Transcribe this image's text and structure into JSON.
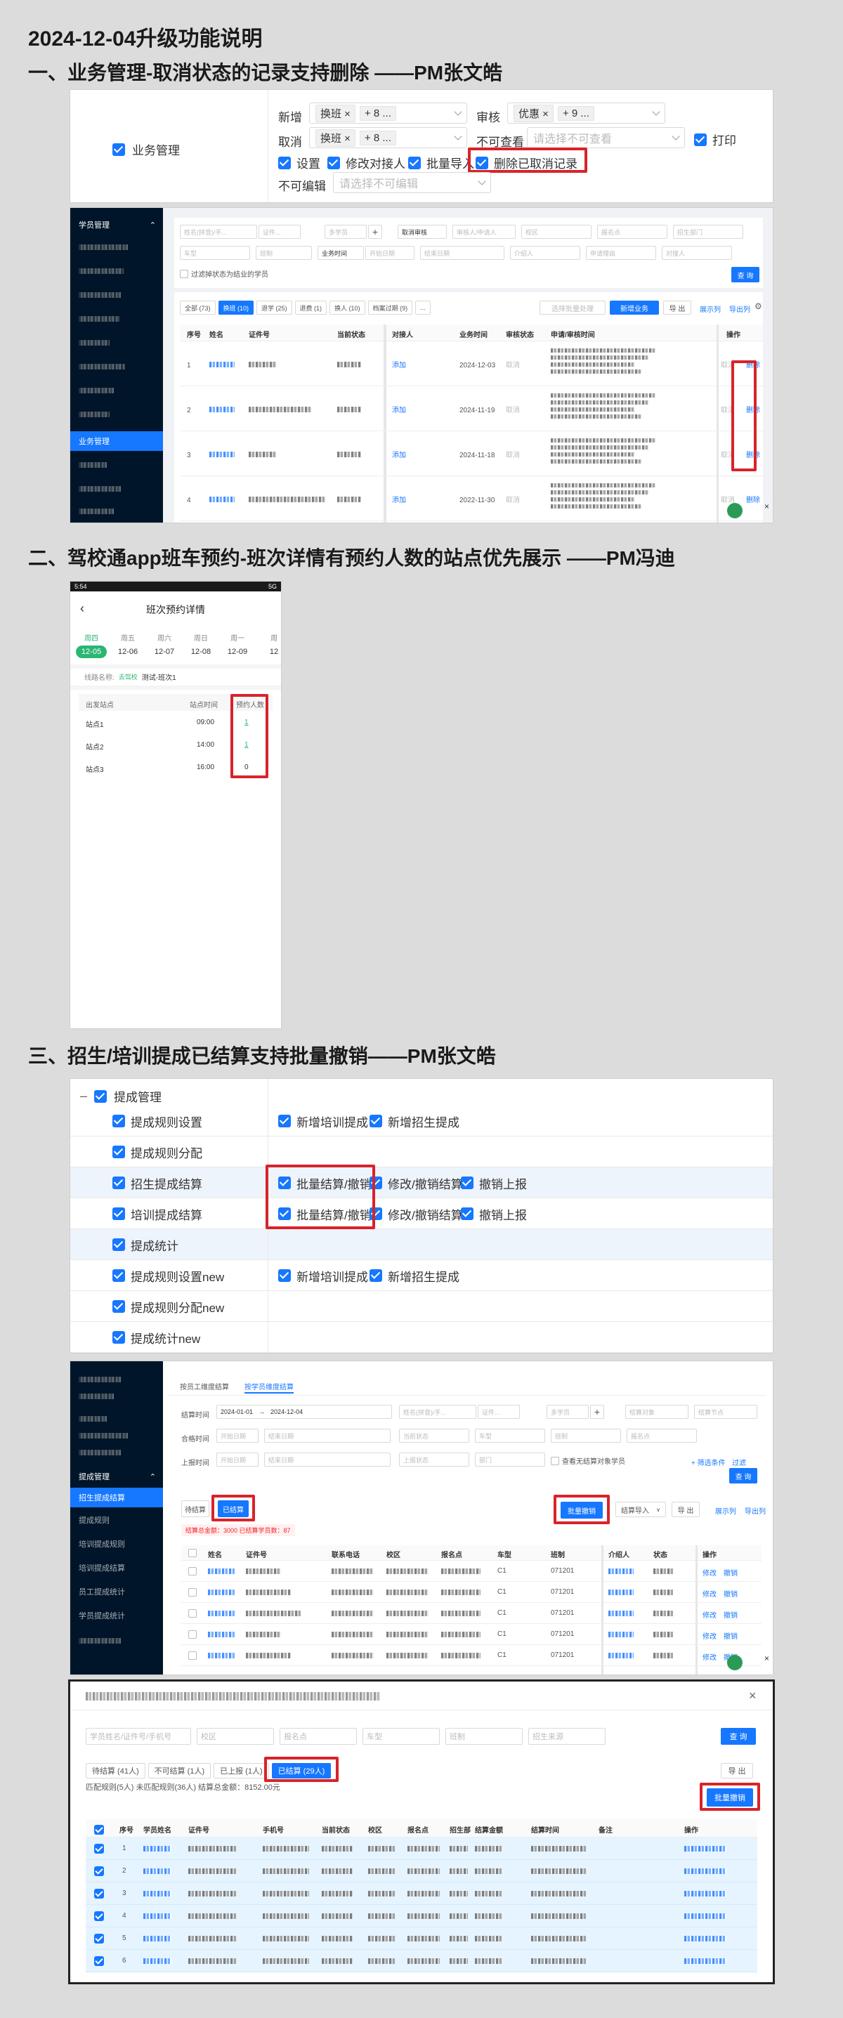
{
  "doc_title": "2024-12-04升级功能说明",
  "sections": [
    {
      "heading": "一、业务管理-取消状态的记录支持删除 ——PM张文皓"
    },
    {
      "heading": "二、驾校通app班车预约-班次详情有预约人数的站点优先展示 ——PM冯迪"
    },
    {
      "heading": "三、招生/培训提成已结算支持批量撤销——PM张文皓"
    }
  ],
  "perm": {
    "main_label": "业务管理",
    "add_label": "新增",
    "add_tag": "换班",
    "add_more": "+ 8 ...",
    "audit_label": "审核",
    "audit_tag": "优惠",
    "audit_more": "+ 9 ...",
    "cancel_label": "取消",
    "cancel_tag": "换班",
    "cancel_more": "+ 8 ...",
    "noview_label": "不可查看",
    "noview_placeholder": "请选择不可查看",
    "print_label": "打印",
    "setting_label": "设置",
    "modify_label": "修改对接人",
    "batch_label": "批量导入",
    "delete_cancel_label": "删除已取消记录",
    "noedit_label": "不可编辑",
    "noedit_placeholder": "请选择不可编辑"
  },
  "biz": {
    "menu_group": "学员管理",
    "active_menu": "业务管理",
    "f_name": "姓名(拼音)/手...",
    "f_id": "证件...",
    "f_student": "多学员",
    "f_cancel": "取消审核",
    "f_auditor": "审核人/申请人",
    "f_campus": "校区",
    "f_site": "报名点",
    "f_dept": "招生部门",
    "f_cartype": "车型",
    "f_class": "班制",
    "f_biztime": "业务时间",
    "f_start": "开始日期",
    "f_end": "结束日期",
    "f_intro": "介绍人",
    "f_reason": "申请理由",
    "f_contact": "对接人",
    "filter_graduated": "过滤掉状态为结业的学员",
    "query": "查 询",
    "tabs": [
      "全部 (73)",
      "换班 (10)",
      "退学 (25)",
      "退费 (1)",
      "换人 (10)",
      "档案过期 (9)",
      "..."
    ],
    "batch_audit": "选择批量处理",
    "new_biz": "新增业务",
    "export": "导 出",
    "col_expand": "展示列",
    "col_export": "导出列",
    "headers": [
      "序号",
      "姓名",
      "证件号",
      "当前状态",
      "对接人",
      "业务时间",
      "审核状态",
      "申请/审核时间",
      "操作"
    ],
    "add_text": "添加",
    "cancel_text": "取消",
    "delete_text": "删除",
    "rows": [
      {
        "no": "1",
        "date": "2024-12-03"
      },
      {
        "no": "2",
        "date": "2024-11-19"
      },
      {
        "no": "3",
        "date": "2024-11-18"
      },
      {
        "no": "4",
        "date": "2022-11-30"
      }
    ]
  },
  "app": {
    "status_time": "5:54",
    "status_right": "5G",
    "title": "班次预约详情",
    "days": [
      {
        "week": "周四",
        "date": "12-05"
      },
      {
        "week": "周五",
        "date": "12-06"
      },
      {
        "week": "周六",
        "date": "12-07"
      },
      {
        "week": "周日",
        "date": "12-08"
      },
      {
        "week": "周一",
        "date": "12-09"
      },
      {
        "week": "周",
        "date": "12"
      }
    ],
    "line_label": "线路名称:",
    "line_tag": "去驾校",
    "line_name": "测试-班次1",
    "col_station": "出发站点",
    "col_time": "站点时间",
    "col_count": "预约人数",
    "stations": [
      {
        "name": "站点1",
        "time": "09:00",
        "count": "1"
      },
      {
        "name": "站点2",
        "time": "14:00",
        "count": "1"
      },
      {
        "name": "站点3",
        "time": "16:00",
        "count": "0"
      }
    ]
  },
  "comm": {
    "root": "提成管理",
    "rows": [
      {
        "label": "提成规则设置",
        "items": [
          "新增培训提成",
          "新增招生提成"
        ]
      },
      {
        "label": "提成规则分配",
        "items": []
      },
      {
        "label": "招生提成结算",
        "items": [
          "批量结算/撤销",
          "修改/撤销结算",
          "撤销上报"
        ]
      },
      {
        "label": "培训提成结算",
        "items": [
          "批量结算/撤销",
          "修改/撤销结算",
          "撤销上报"
        ]
      },
      {
        "label": "提成统计",
        "items": []
      },
      {
        "label": "提成规则设置new",
        "items": [
          "新增培训提成",
          "新增招生提成"
        ]
      },
      {
        "label": "提成规则分配new",
        "items": []
      },
      {
        "label": "提成统计new",
        "items": []
      }
    ]
  },
  "settle": {
    "top_tab1": "按员工维度结算",
    "top_tab2": "按学员维度结算",
    "menu_group": "提成管理",
    "menus": [
      "招生提成结算",
      "提成规则",
      "培训提成规则",
      "培训提成结算",
      "员工提成统计",
      "学员提成统计"
    ],
    "settle_time": "结算时间",
    "d1": "2024-01-01",
    "d2": "2024-12-04",
    "f_name": "姓名(拼音)/手...",
    "f_id": "证件...",
    "f_multi": "多学员",
    "f_object": "结算对象",
    "f_node": "结算节点",
    "pass_time": "合格时间",
    "start": "开始日期",
    "end": "结束日期",
    "cur_status": "当前状态",
    "cartype": "车型",
    "classtype": "班制",
    "site": "报名点",
    "report_time": "上报时间",
    "report_status": "上报状态",
    "dept": "部门",
    "no_settle_only": "查看无结算对象学员",
    "filter_cond": "+ 筛选条件",
    "filter": "过滤",
    "query": "查 询",
    "tab_pending": "待结算",
    "tab_done": "已结算",
    "summary": "结算总金额：3000 已结算学员数：87",
    "batch_revoke": "批量撤销",
    "settle_import": "结算导入",
    "export": "导 出",
    "col_expand": "展示列",
    "col_export": "导出列",
    "headers": [
      "姓名",
      "证件号",
      "联系电话",
      "校区",
      "报名点",
      "车型",
      "班制",
      "介绍人",
      "状态",
      "操作"
    ],
    "cartype_val": "C1",
    "class_val": "071201",
    "edit": "修改",
    "revoke": "撤销",
    "rows": 5
  },
  "modal": {
    "f_name": "学员姓名/证件号/手机号",
    "f_campus": "校区",
    "f_site": "报名点",
    "f_cartype": "车型",
    "f_class": "班制",
    "f_source": "招生来源",
    "query": "查 询",
    "tabs": [
      "待结算 (41人)",
      "不可结算 (1人)",
      "已上报 (1人)",
      "已结算 (29人)"
    ],
    "export": "导 出",
    "summary": "匹配规则(5人)  未匹配规则(36人)  结算总金额：8152.00元",
    "batch_revoke": "批量撤销",
    "headers": [
      "序号",
      "学员姓名",
      "证件号",
      "手机号",
      "当前状态",
      "校区",
      "报名点",
      "招生部",
      "结算金额",
      "结算时间",
      "备注",
      "操作"
    ],
    "rows": [
      "1",
      "2",
      "3",
      "4",
      "5",
      "6"
    ]
  }
}
